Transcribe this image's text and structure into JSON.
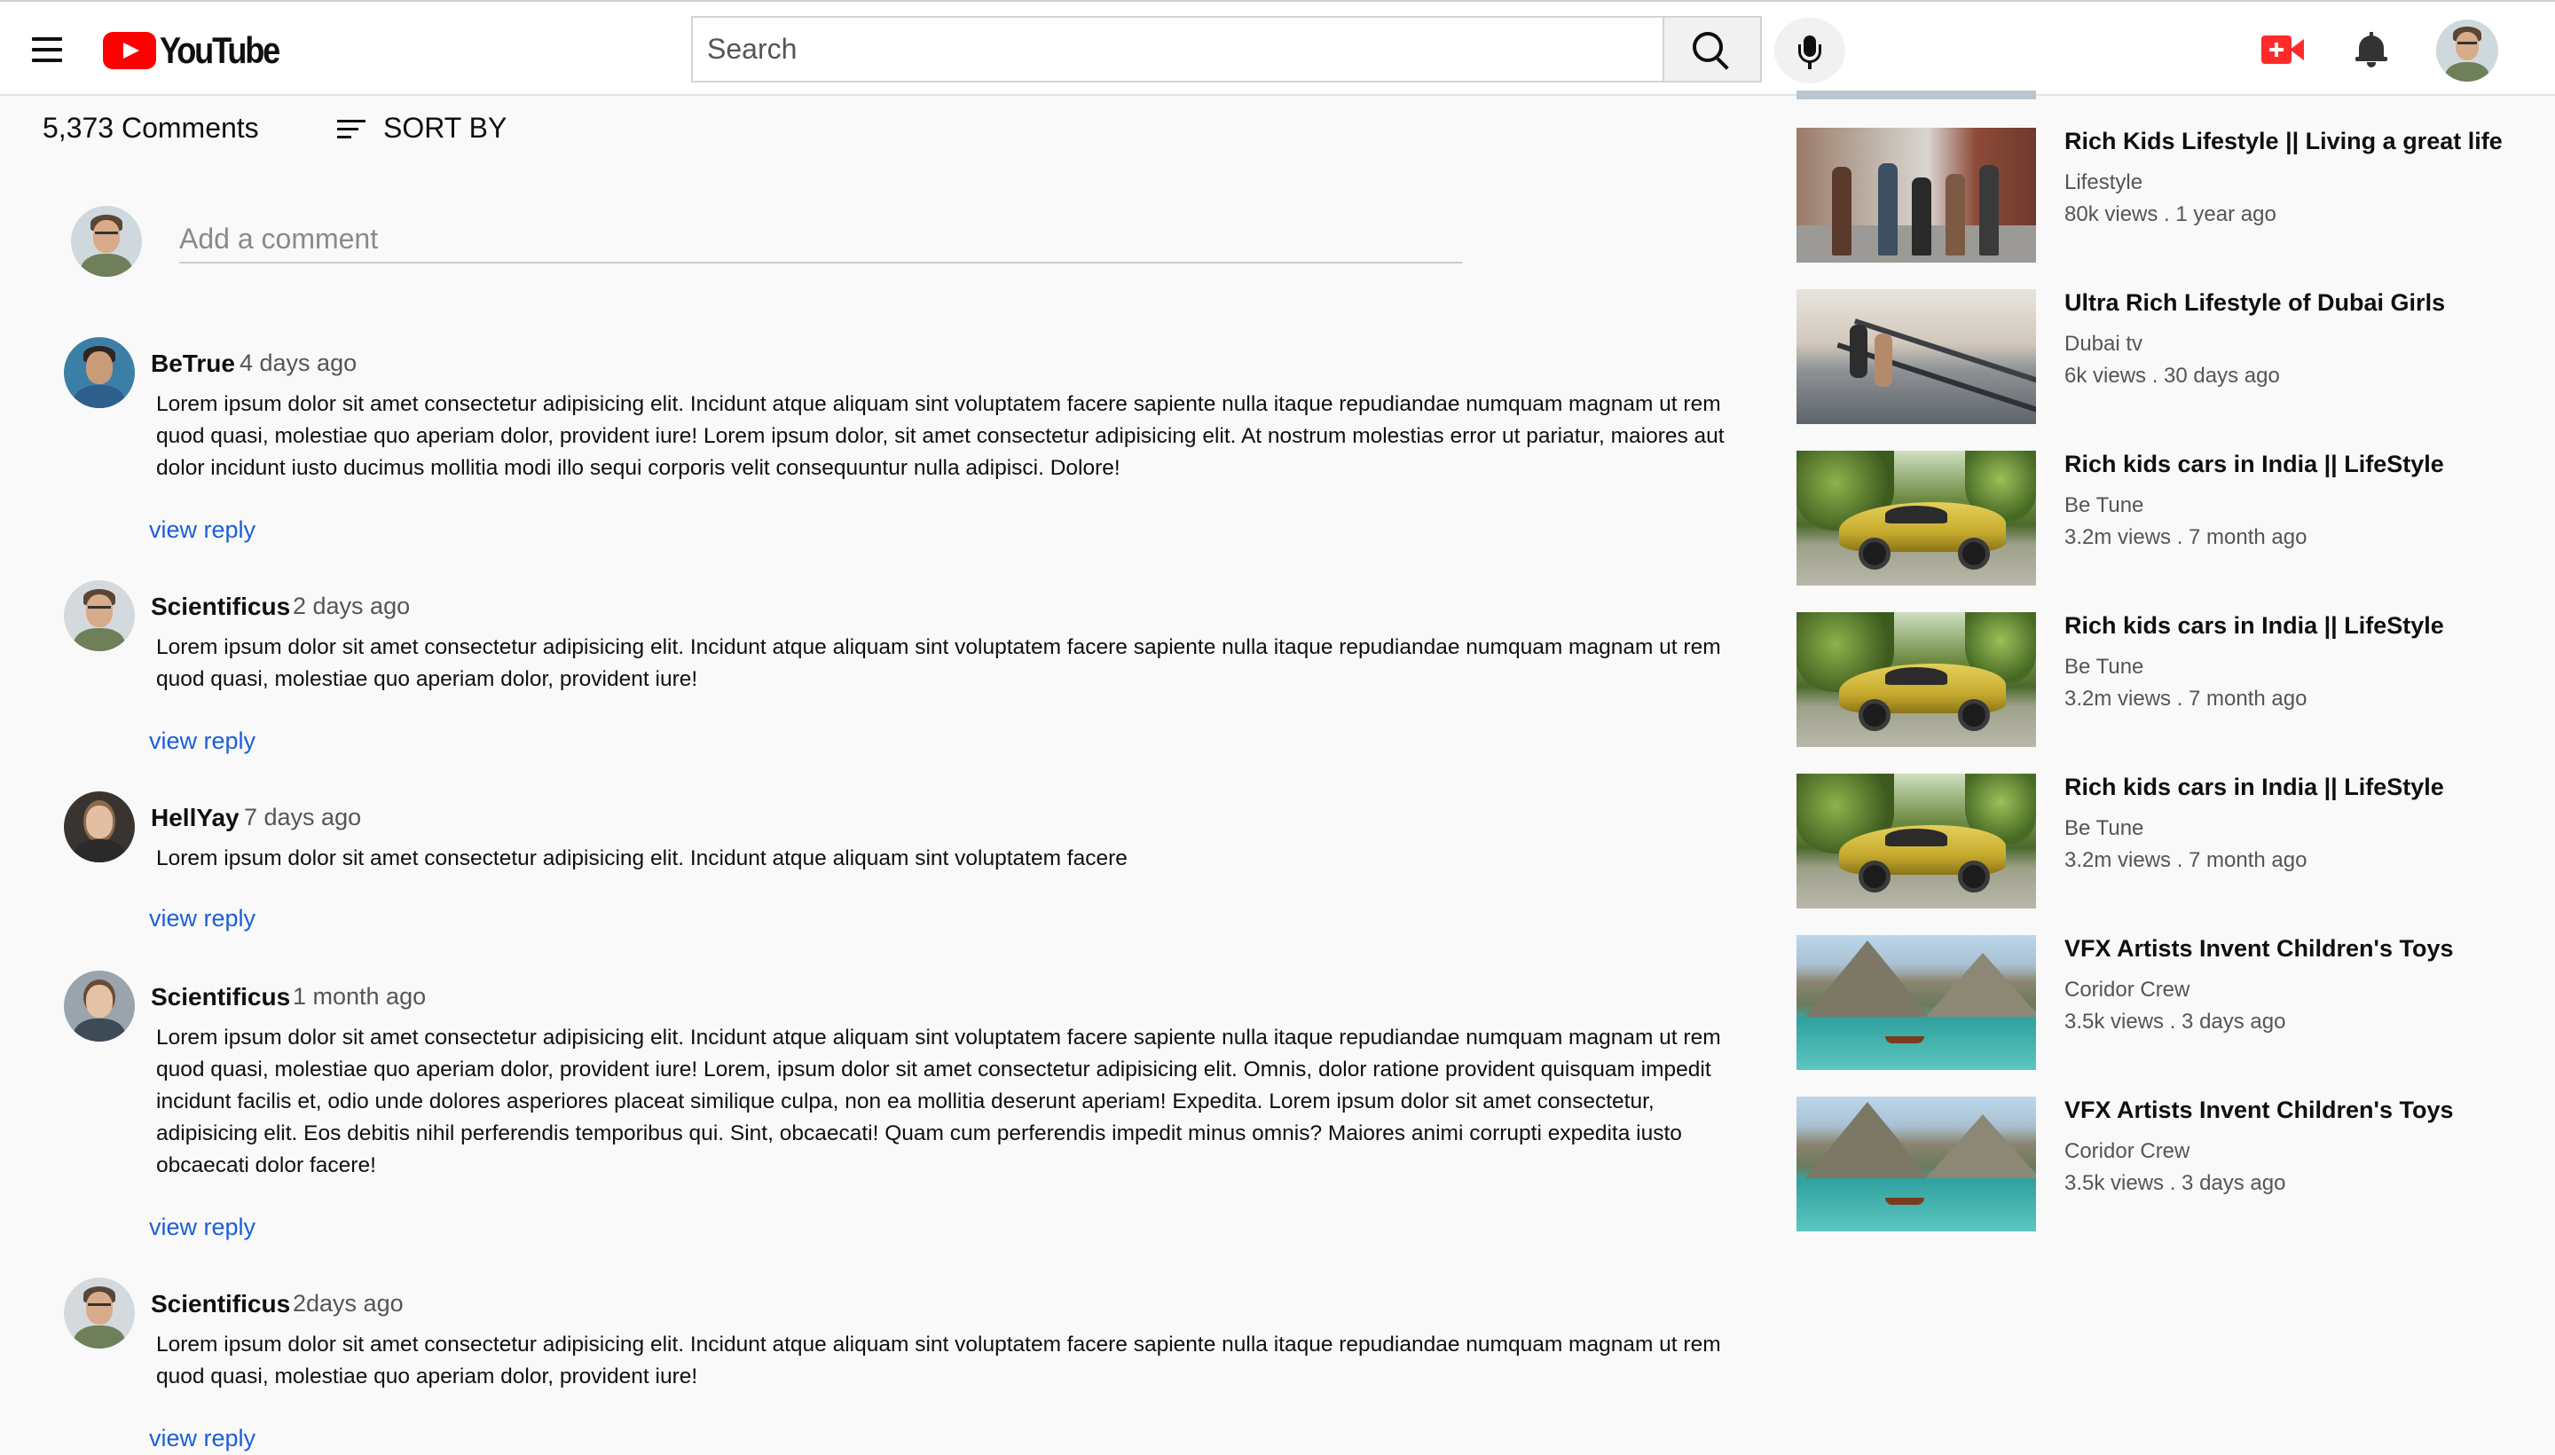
{
  "header": {
    "logo_text": "YouTube",
    "search_placeholder": "Search",
    "colors": {
      "brand_red": "#ff0000",
      "link_blue": "#1a5fd6"
    }
  },
  "comments_section": {
    "count_label": "5,373 Comments",
    "sort_label": "SORT BY",
    "add_comment_placeholder": "Add a comment",
    "reply_label": "view reply",
    "comments": [
      {
        "author": "BeTrue",
        "time": "4 days ago",
        "text": "Lorem ipsum dolor sit amet consectetur adipisicing elit. Incidunt atque aliquam sint voluptatem facere sapiente nulla itaque repudiandae numquam magnam ut rem quod quasi, molestiae quo aperiam dolor, provident iure! Lorem ipsum dolor, sit amet consectetur adipisicing elit. At nostrum molestias error ut pariatur, maiores aut dolor incidunt iusto ducimus mollitia modi illo sequi corporis velit consequuntur nulla adipisci. Dolore!",
        "reply": "view reply"
      },
      {
        "author": "Scientificus",
        "time": "2 days ago",
        "text": "Lorem ipsum dolor sit amet consectetur adipisicing elit. Incidunt atque aliquam sint voluptatem facere sapiente nulla itaque repudiandae numquam magnam ut rem quod quasi, molestiae quo aperiam dolor, provident iure!",
        "reply": "view reply"
      },
      {
        "author": "HellYay",
        "time": "7 days ago",
        "text": "Lorem ipsum dolor sit amet consectetur adipisicing elit. Incidunt atque aliquam sint voluptatem facere",
        "reply": "view reply"
      },
      {
        "author": "Scientificus",
        "time": "1 month ago",
        "text": "Lorem ipsum dolor sit amet consectetur adipisicing elit. Incidunt atque aliquam sint voluptatem facere sapiente nulla itaque repudiandae numquam magnam ut rem quod quasi, molestiae quo aperiam dolor, provident iure! Lorem, ipsum dolor sit amet consectetur adipisicing elit. Omnis, dolor ratione provident quisquam impedit incidunt facilis et, odio unde dolores asperiores placeat similique culpa, non ea mollitia deserunt aperiam! Expedita. Lorem ipsum dolor sit amet consectetur, adipisicing elit. Eos debitis nihil perferendis temporibus qui. Sint, obcaecati! Quam cum perferendis impedit minus omnis? Maiores animi corrupti expedita iusto obcaecati dolor facere!",
        "reply": "view reply"
      },
      {
        "author": "Scientificus",
        "time": "2days ago",
        "text": "Lorem ipsum dolor sit amet consectetur adipisicing elit. Incidunt atque aliquam sint voluptatem facere sapiente nulla itaque repudiandae numquam magnam ut rem quod quasi, molestiae quo aperiam dolor, provident iure!",
        "reply": "view reply"
      }
    ]
  },
  "sidebar": {
    "videos": [
      {
        "title": "Rich Kids Lifestyle || Living a great life",
        "channel": "Lifestyle",
        "meta": "80k views . 1 year ago",
        "thumb": "street-group"
      },
      {
        "title": "Ultra Rich Lifestyle of Dubai Girls",
        "channel": "Dubai tv",
        "meta": "6k views . 30 days ago",
        "thumb": "escalator"
      },
      {
        "title": "Rich kids cars in India || LifeStyle",
        "channel": "Be Tune",
        "meta": "3.2m views . 7 month ago",
        "thumb": "yellow-car"
      },
      {
        "title": "Rich kids cars in India || LifeStyle",
        "channel": "Be Tune",
        "meta": "3.2m views . 7 month ago",
        "thumb": "yellow-car"
      },
      {
        "title": "Rich kids cars in India || LifeStyle",
        "channel": "Be Tune",
        "meta": "3.2m views . 7 month ago",
        "thumb": "yellow-car"
      },
      {
        "title": "VFX Artists Invent Children's Toys",
        "channel": "Coridor Crew",
        "meta": "3.5k views . 3 days ago",
        "thumb": "mountain-lake"
      },
      {
        "title": "VFX Artists Invent Children's Toys",
        "channel": "Coridor Crew",
        "meta": "3.5k views . 3 days ago",
        "thumb": "mountain-lake"
      }
    ]
  }
}
